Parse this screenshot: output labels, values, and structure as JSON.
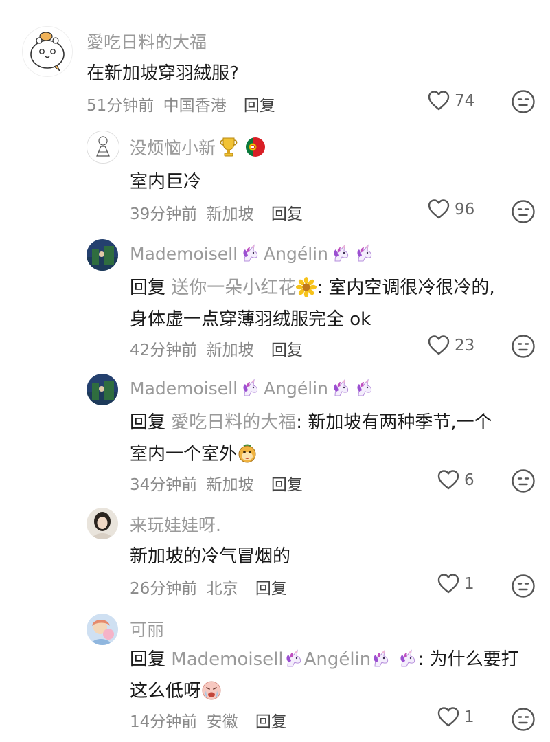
{
  "comments": [
    {
      "username": "愛吃日料的大福",
      "text": "在新加坡穿羽絨服?",
      "time": "51分钟前",
      "location": "中国香港",
      "reply_label": "回复",
      "likes": "74"
    },
    {
      "username": "没烦恼小新",
      "text": "室内巨冷",
      "time": "39分钟前",
      "location": "新加坡",
      "reply_label": "回复",
      "likes": "96"
    },
    {
      "username_a": "Mademoisell",
      "username_b": "Angélin",
      "reply_prefix": "回复",
      "reply_target": "送你一朵小红花",
      "text_line1": ": 室内空调很冷很冷的,",
      "text_line2": "身体虚一点穿薄羽绒服完全 ok",
      "time": "42分钟前",
      "location": "新加坡",
      "reply_label": "回复",
      "likes": "23"
    },
    {
      "username_a": "Mademoisell",
      "username_b": "Angélin",
      "reply_prefix": "回复",
      "reply_target": "愛吃日料的大福",
      "text_line1": ": 新加坡有两种季节,一个",
      "text_line2": "室内一个室外",
      "time": "34分钟前",
      "location": "新加坡",
      "reply_label": "回复",
      "likes": "6"
    },
    {
      "username": "来玩娃娃呀.",
      "text": "新加坡的冷气冒烟的",
      "time": "26分钟前",
      "location": "北京",
      "reply_label": "回复",
      "likes": "1"
    },
    {
      "username": "可丽",
      "reply_prefix": "回复",
      "reply_target_a": "Mademoisell",
      "reply_target_b": "Angélin",
      "text_line1": ": 为什么要打",
      "text_line2": "这么低呀",
      "time": "14分钟前",
      "location": "安徽",
      "reply_label": "回复",
      "likes": "1"
    }
  ],
  "icons": {
    "like": "heart-outline-icon",
    "emoji": "meh-face-icon"
  },
  "colors": {
    "username": "#9a9a9a",
    "text": "#1a1a1a",
    "meta": "#8a8a8a"
  }
}
